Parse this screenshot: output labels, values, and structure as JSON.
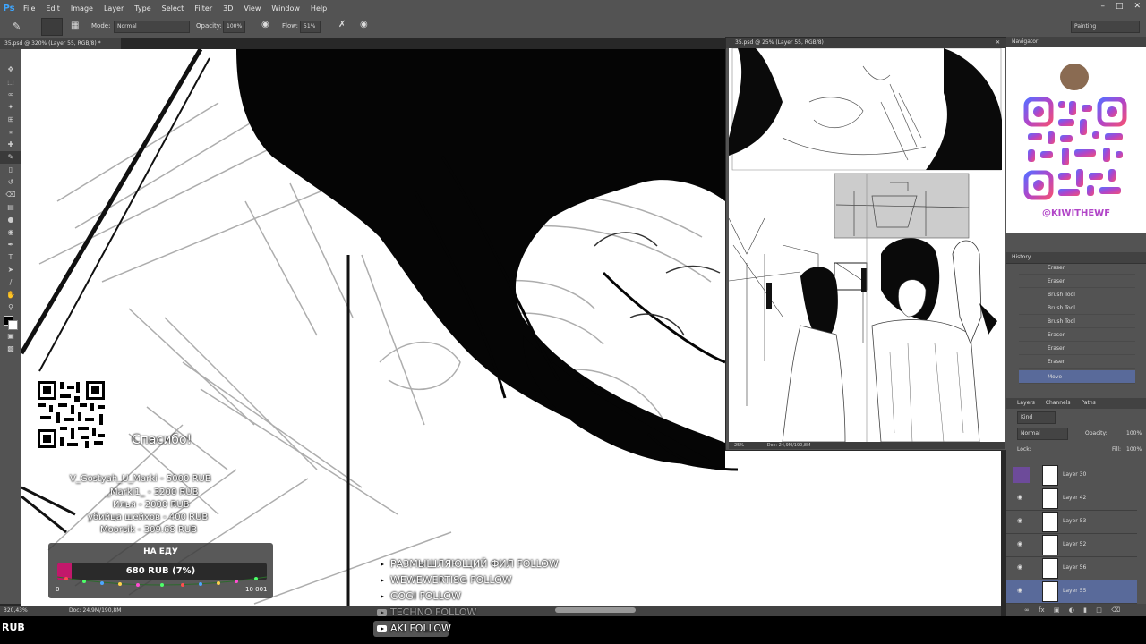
{
  "menubar": {
    "logo": "Ps",
    "items": [
      "File",
      "Edit",
      "Image",
      "Layer",
      "Type",
      "Select",
      "Filter",
      "3D",
      "View",
      "Window",
      "Help"
    ]
  },
  "options": {
    "mode_label": "Mode:",
    "mode_value": "Normal",
    "opacity_label": "Opacity:",
    "opacity_value": "100%",
    "flow_label": "Flow:",
    "flow_value": "51%",
    "workspace": "Painting"
  },
  "document": {
    "tab_title": "35.psd @ 320% (Layer 55, RGB/8) *",
    "zoom": "320,43%",
    "doc_size": "Doc: 24,9M/190,8M"
  },
  "float_window": {
    "title": "35.psd @ 25% (Layer 55, RGB/8)",
    "zoom": "25%",
    "doc_size": "Doc: 24,9M/190,8M"
  },
  "navigator": {
    "tab": "Navigator",
    "handle": "@KIWITHEWF"
  },
  "history": {
    "tab": "History",
    "items": [
      "Eraser",
      "Eraser",
      "Brush Tool",
      "Brush Tool",
      "Brush Tool",
      "Eraser",
      "Eraser",
      "Eraser",
      "Move"
    ]
  },
  "layers": {
    "tabs": [
      "Layers",
      "Channels",
      "Paths"
    ],
    "kind": "Kind",
    "blend": "Normal",
    "opacity_label": "Opacity:",
    "opacity_value": "100%",
    "lock_label": "Lock:",
    "fill_label": "Fill:",
    "fill_value": "100%",
    "items": [
      "Layer 30",
      "Layer 42",
      "Layer 53",
      "Layer 52",
      "Layer 56",
      "Layer 55"
    ]
  },
  "overlay": {
    "thanks": "Спасибо!",
    "donations": [
      "V_Gostyah_U_Marki - 5000 RUB",
      "_Marki1_ - 3200 RUB",
      "Илья - 2000 RUB",
      "убийца шейхов - 400 RUB",
      "Moorsik - 309.68 RUB"
    ],
    "goal_title": "НА ЕДУ",
    "goal_amount": "680 RUB (7%)",
    "goal_progress": 0.07,
    "goal_min": "0",
    "goal_max": "10 001",
    "socials": [
      "РАЗМЫШЛЯЮЩИЙ ФИЛ  FOLLOW",
      "WEWEWERTISG  FOLLOW",
      "GOGI  FOLLOW",
      "TECHNO  FOLLOW",
      "AKI  FOLLOW"
    ],
    "bottom_left": "RUB"
  }
}
